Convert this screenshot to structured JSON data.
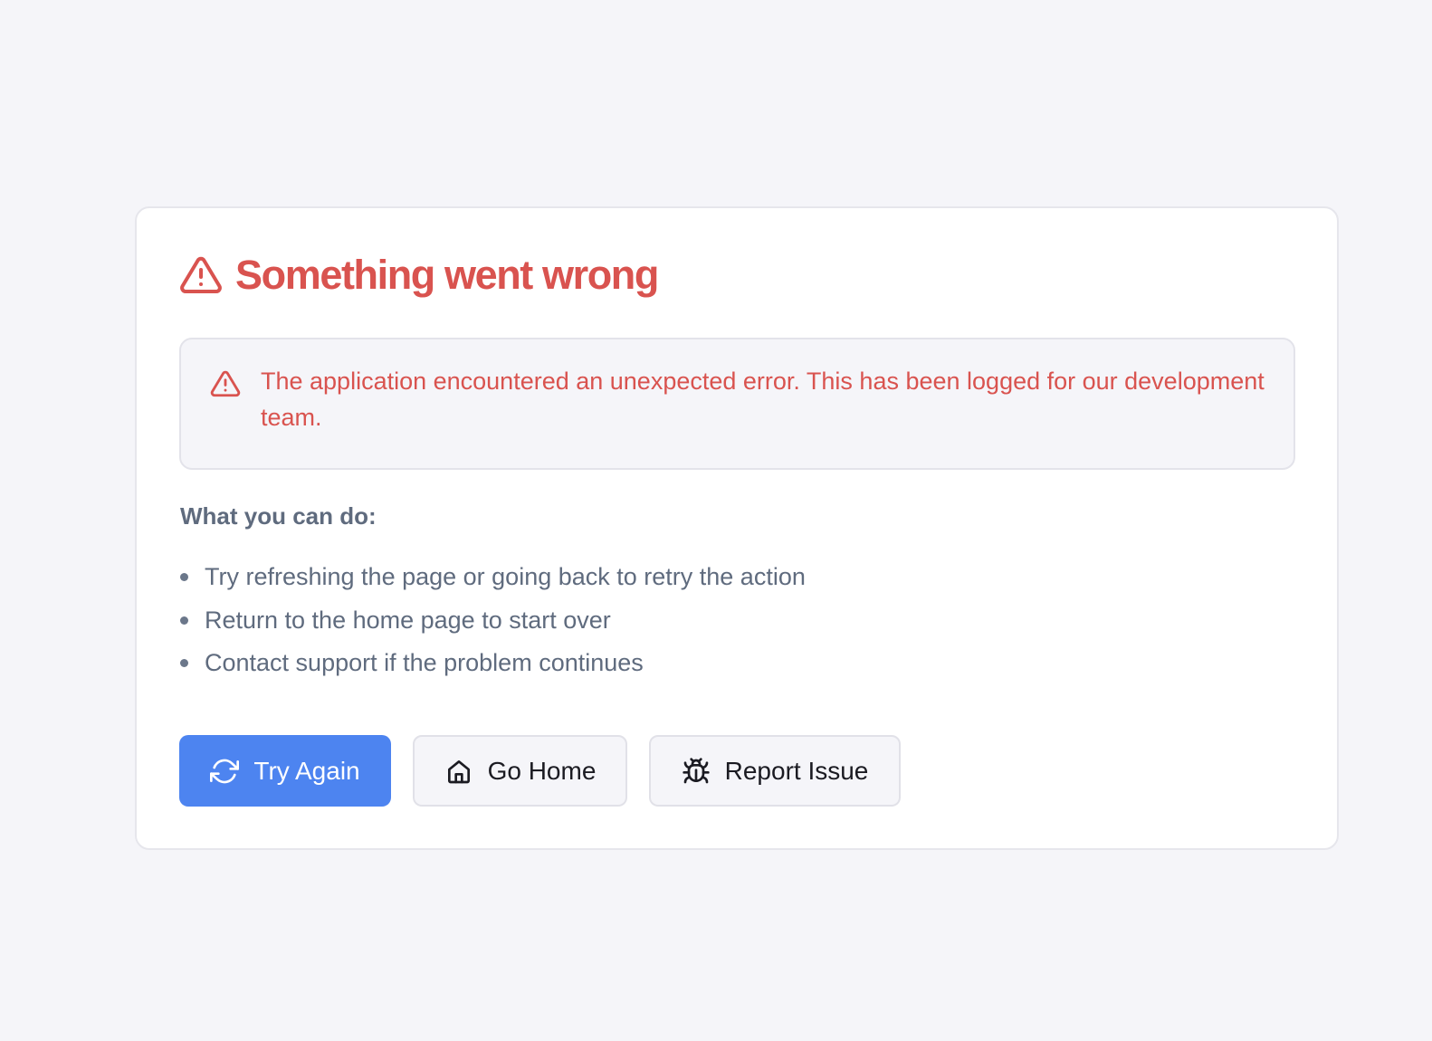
{
  "error": {
    "title": "Something went wrong",
    "title_icon": "alert-triangle-icon",
    "message": "The application encountered an unexpected error. This has been logged for our development team.",
    "message_icon": "alert-triangle-icon"
  },
  "help": {
    "heading": "What you can do:",
    "items": [
      "Try refreshing the page or going back to retry the action",
      "Return to the home page to start over",
      "Contact support if the problem continues"
    ]
  },
  "actions": {
    "try_again": {
      "label": "Try Again",
      "icon": "refresh-icon"
    },
    "go_home": {
      "label": "Go Home",
      "icon": "home-icon"
    },
    "report_issue": {
      "label": "Report Issue",
      "icon": "bug-icon"
    }
  },
  "colors": {
    "error": "#d9534f",
    "primary": "#4d84f0",
    "muted_text": "#5f6b7e",
    "background": "#f5f5f9",
    "card": "#ffffff"
  }
}
